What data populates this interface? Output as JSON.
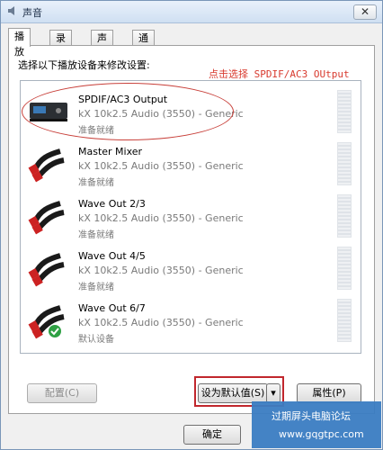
{
  "window": {
    "title": "声音"
  },
  "tabs": [
    {
      "label": "播放"
    },
    {
      "label": "录制"
    },
    {
      "label": "声音"
    },
    {
      "label": "通信"
    }
  ],
  "prompt": "选择以下播放设备来修改设置:",
  "annotation": "点击选择 SPDIF/AC3 OUtput",
  "devices": [
    {
      "name": "SPDIF/AC3 Output",
      "driver": "kX 10k2.5 Audio (3550) - Generic",
      "status": "准备就绪",
      "icon": "spdif-device-icon"
    },
    {
      "name": "Master Mixer",
      "driver": "kX 10k2.5 Audio (3550) - Generic",
      "status": "准备就绪",
      "icon": "rca-cable-icon"
    },
    {
      "name": "Wave Out 2/3",
      "driver": "kX 10k2.5 Audio (3550) - Generic",
      "status": "准备就绪",
      "icon": "rca-cable-icon"
    },
    {
      "name": "Wave Out 4/5",
      "driver": "kX 10k2.5 Audio (3550) - Generic",
      "status": "准备就绪",
      "icon": "rca-cable-icon"
    },
    {
      "name": "Wave Out 6/7",
      "driver": "kX 10k2.5 Audio (3550) - Generic",
      "status": "默认设备",
      "icon": "rca-cable-icon"
    }
  ],
  "buttons": {
    "configure": "配置(C)",
    "set_default": "设为默认值(S)",
    "properties": "属性(P)",
    "ok": "确定"
  },
  "watermark": {
    "line1": "过期屏头电脑论坛",
    "line2": "www.gqgtpc.com"
  },
  "colors": {
    "annotation": "#d83a2e",
    "highlight": "#c1272d",
    "default_check": "#2ea043"
  }
}
